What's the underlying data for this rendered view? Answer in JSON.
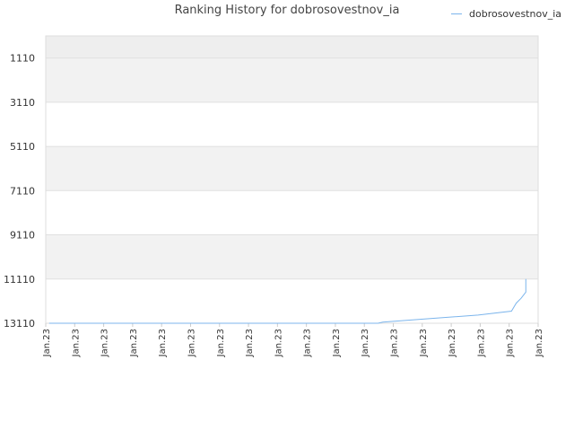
{
  "chart_data": {
    "type": "line",
    "title": "Ranking History for dobrosovestnov_ia",
    "xlabel": "",
    "ylabel": "",
    "y_reversed": true,
    "ylim": [
      13110,
      110
    ],
    "y_ticks": [
      1110,
      3110,
      5110,
      7110,
      9110,
      11110,
      13110
    ],
    "x_tick_labels": [
      "Jan.23",
      "Jan.23",
      "Jan.23",
      "Jan.23",
      "Jan.23",
      "Jan.23",
      "Jan.23",
      "Jan.23",
      "Jan.23",
      "Jan.23",
      "Jan.23",
      "Jan.23",
      "Jan.23",
      "Jan.23",
      "Jan.23",
      "Jan.23",
      "Jan.23",
      "Jan.23"
    ],
    "grid": true,
    "legend_position": "top-right",
    "series": [
      {
        "name": "dobrosovestnov_ia",
        "color": "#7cb5ec",
        "x": [
          0.0,
          0.69,
          0.7,
          0.8,
          0.9,
          0.97,
          0.98,
          0.99,
          1.0,
          1.0
        ],
        "y": [
          13110,
          13110,
          13060,
          12900,
          12740,
          12560,
          12200,
          11980,
          11700,
          11110
        ]
      }
    ]
  }
}
